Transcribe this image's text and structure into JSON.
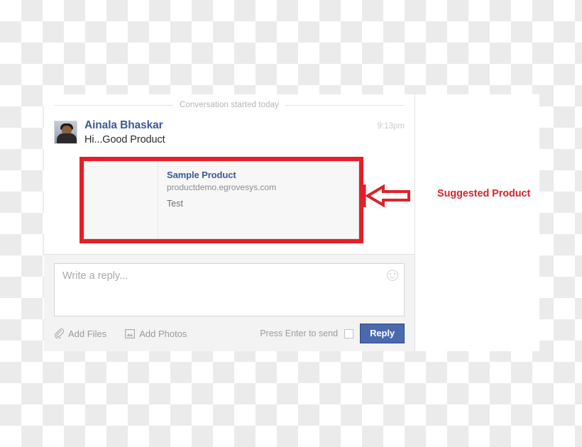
{
  "conversation": {
    "divider_label": "Conversation started today",
    "message": {
      "sender": "Ainala Bhaskar",
      "time": "9:13pm",
      "text": "Hi...Good Product",
      "avatar_icon": "user-photo-avatar"
    },
    "attachment": {
      "title": "Sample Product",
      "url": "productdemo.egrovesys.com",
      "description": "Test",
      "thumbnail_icon": "product-thumbnail-placeholder"
    }
  },
  "composer": {
    "placeholder": "Write a reply...",
    "value": "",
    "emoji_icon": "smiley-icon",
    "add_files_label": "Add Files",
    "add_files_icon": "paperclip-icon",
    "add_photos_label": "Add Photos",
    "add_photos_icon": "photo-icon",
    "press_enter_label": "Press Enter to send",
    "enter_checkbox_checked": false,
    "reply_button_label": "Reply"
  },
  "annotation": {
    "label": "Suggested Product",
    "arrow_icon": "left-arrow-callout-icon"
  },
  "colors": {
    "brand_blue": "#3b5998",
    "reply_button_blue": "#4b69ad",
    "annotation_red": "#dd2229",
    "highlight_red": "#e41f26",
    "muted_text": "#9a9a9a"
  }
}
